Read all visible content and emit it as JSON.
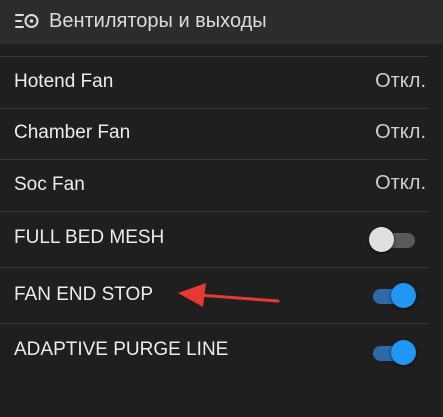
{
  "header": {
    "title": "Вентиляторы и выходы",
    "icon": "fan-icon"
  },
  "rows": [
    {
      "label": "Hotend Fan",
      "value": "Откл.",
      "type": "value"
    },
    {
      "label": "Chamber Fan",
      "value": "Откл.",
      "type": "value"
    },
    {
      "label": "Soc Fan",
      "value": "Откл.",
      "type": "value"
    },
    {
      "label": "FULL BED MESH",
      "type": "toggle",
      "checked": false
    },
    {
      "label": "FAN END STOP",
      "type": "toggle",
      "checked": true
    },
    {
      "label": "ADAPTIVE PURGE LINE",
      "type": "toggle",
      "checked": true
    }
  ],
  "colors": {
    "background": "#1f1f1f",
    "header_background": "#2c2c2c",
    "toggle_on": "#2196f3",
    "toggle_off": "#e0e0e0",
    "annotation_arrow": "#e53935"
  }
}
